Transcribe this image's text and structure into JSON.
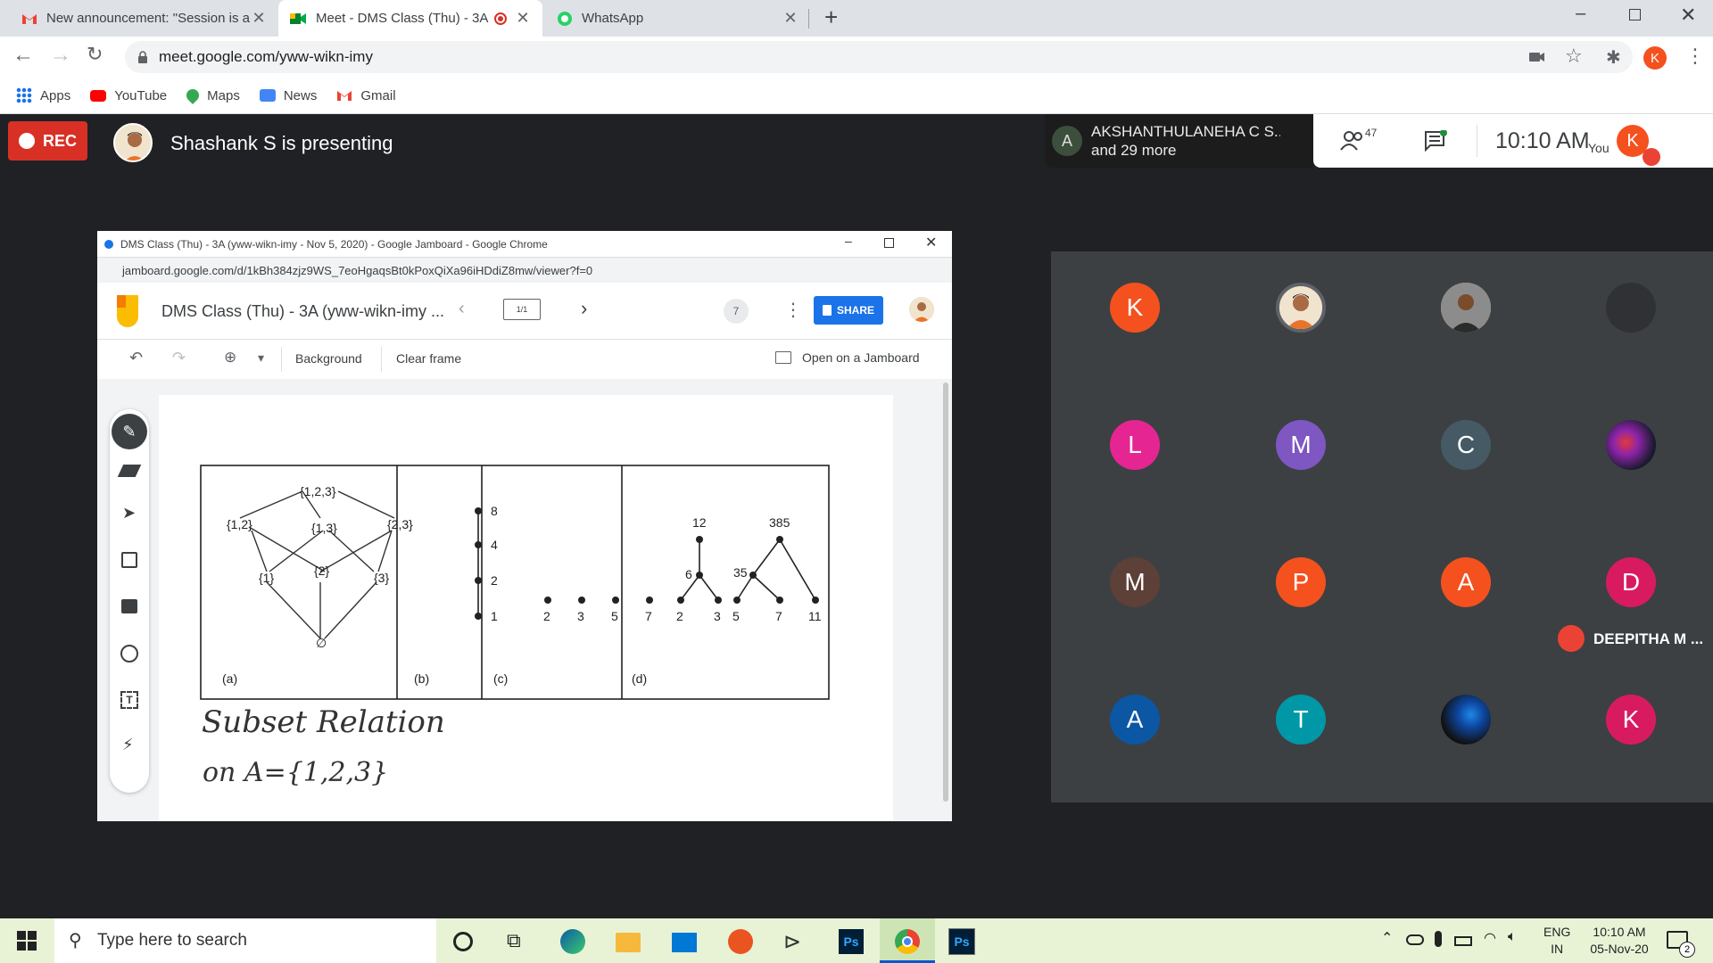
{
  "browser": {
    "tabs": [
      {
        "label": "New announcement: \"Session is a"
      },
      {
        "label": "Meet - DMS Class (Thu) - 3A"
      },
      {
        "label": "WhatsApp"
      }
    ],
    "url": "meet.google.com/yww-wikn-imy",
    "profile_initial": "K",
    "bookmarks": [
      "Apps",
      "YouTube",
      "Maps",
      "News",
      "Gmail"
    ]
  },
  "meet": {
    "rec_label": "REC",
    "presenting_text": "Shashank S is presenting",
    "joined": {
      "initial": "A",
      "names": "AKSHANTHULANEHA C S...",
      "more": "and 29 more"
    },
    "participants_count": "47",
    "time": "10:10 AM",
    "you_label": "You",
    "you_initial": "K",
    "muted_name": "DEEPITHA M ...",
    "tiles": [
      {
        "initial": "K",
        "color": "#f4511e"
      },
      {
        "initial": "",
        "color": "photo"
      },
      {
        "initial": "",
        "color": "photo2"
      },
      {
        "initial": "",
        "color": "#303134"
      },
      {
        "initial": "L",
        "color": "#e52592"
      },
      {
        "initial": "M",
        "color": "#7e57c2"
      },
      {
        "initial": "C",
        "color": "#455a64"
      },
      {
        "initial": "",
        "color": "galaxy"
      },
      {
        "initial": "M",
        "color": "#5d4037"
      },
      {
        "initial": "P",
        "color": "#f4511e"
      },
      {
        "initial": "A",
        "color": "#f4511e"
      },
      {
        "initial": "D",
        "color": "#d81b60"
      },
      {
        "initial": "A",
        "color": "#0b57a4"
      },
      {
        "initial": "T",
        "color": "#0097a7"
      },
      {
        "initial": "",
        "color": "bird"
      },
      {
        "initial": "K",
        "color": "#d81b60"
      }
    ]
  },
  "jamboard": {
    "window_title": "DMS Class (Thu) - 3A (yww-wikn-imy - Nov 5, 2020) - Google Jamboard - Google Chrome",
    "url": "jamboard.google.com/d/1kBh384zjz9WS_7eoHgaqsBt0kPoxQiXa96iHDdiZ8mw/viewer?f=0",
    "doc_title": "DMS Class (Thu) - 3A (yww-wikn-imy ...",
    "frame": "1/1",
    "viewers": "7",
    "share_label": "SHARE",
    "background_label": "Background",
    "clear_label": "Clear frame",
    "open_label": "Open on a Jamboard",
    "diagram": {
      "a_nodes": [
        "{1,2,3}",
        "{1,2}",
        "{1,3}",
        "{2,3}",
        "{1}",
        "{2}",
        "{3}",
        "∅"
      ],
      "b_nodes": [
        "8",
        "4",
        "2",
        "1"
      ],
      "c_nodes": [
        "2",
        "3",
        "5",
        "7"
      ],
      "d_nodes": [
        "12",
        "385",
        "6",
        "35",
        "2",
        "3",
        "5",
        "7",
        "11"
      ],
      "captions": [
        "(a)",
        "(b)",
        "(c)",
        "(d)"
      ]
    },
    "handwriting": [
      "Subset Relation",
      "on A={1,2,3}"
    ]
  },
  "taskbar": {
    "search_placeholder": "Type here to search",
    "lang": "ENG",
    "region": "IN",
    "time": "10:10 AM",
    "date": "05-Nov-20",
    "notifications": "2"
  }
}
